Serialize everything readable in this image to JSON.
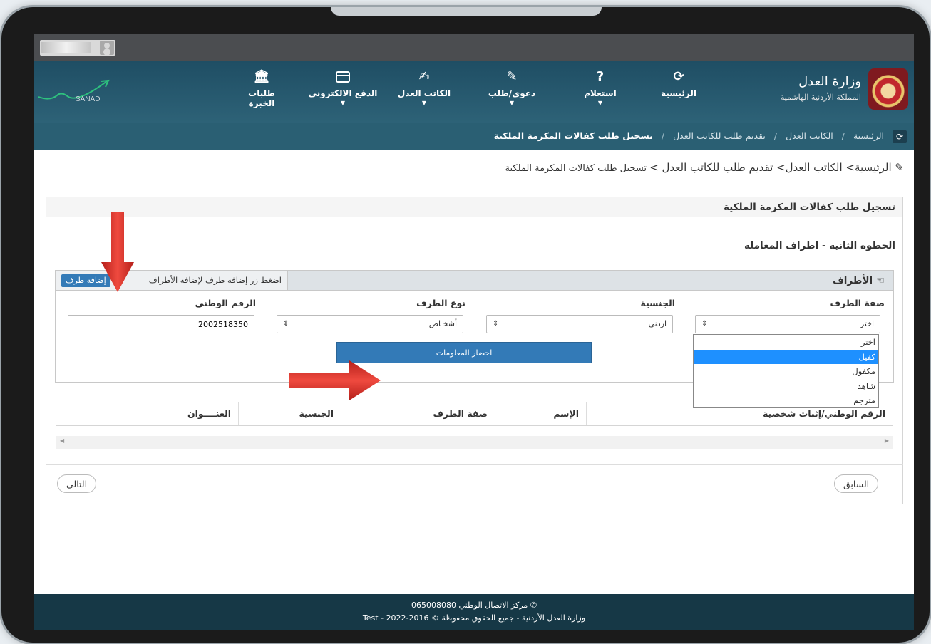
{
  "nav": {
    "brand": "SANAD",
    "items": [
      {
        "label": "الرئيسية",
        "icon": "refresh-icon",
        "glyph": "⟳",
        "caret": ""
      },
      {
        "label": "استعلام",
        "icon": "question-icon",
        "glyph": "?",
        "caret": "▼"
      },
      {
        "label": "دعوى/طلب",
        "icon": "pencil-icon",
        "glyph": "✎",
        "caret": "▼"
      },
      {
        "label": "الكاتب العدل",
        "icon": "edit-icon",
        "glyph": "✍",
        "caret": "▼"
      },
      {
        "label": "الدفع الالكتروني",
        "icon": "credit-card-icon",
        "glyph": "▭",
        "caret": "▼"
      },
      {
        "label": "طلبات الخبرة",
        "icon": "bank-icon",
        "glyph": "🏛",
        "caret": ""
      }
    ],
    "logo": {
      "line1": "وزارة العدل",
      "line2": "المملكة الأردنية الهاشمية"
    }
  },
  "breadcrumb": [
    "الرئيسية",
    "الكاتب العدل",
    "تقديم طلب للكاتب العدل",
    "تسجيل طلب كفالات المكرمة الملكية"
  ],
  "breadcrumb_sep": "/",
  "pathline": {
    "main": "الرئيسية> الكاتب العدل> تقديم طلب للكاتب العدل >",
    "tail": " تسجيل طلب كفالات المكرمة الملكية"
  },
  "panel": {
    "title": "تسجيل طلب كفالات المكرمة الملكية",
    "step": "الخطوة الثانية - اطراف المعاملة"
  },
  "parties": {
    "title": "الأطراف",
    "hint": "اضغط زر إضافة طرف لإضافة الأطراف",
    "add_button": "إضافة طرف",
    "fields": {
      "role_label": "صفة الطرف",
      "role_value": "اختر",
      "nationality_label": "الجنسية",
      "nationality_value": "اردنى",
      "type_label": "نوع الطرف",
      "type_value": "أشخـاص",
      "national_id_label": "الرقم الوطني",
      "national_id_value": "2002518350"
    },
    "fetch_button": "احضار المعلومات",
    "role_options": [
      "اختر",
      "كفيل",
      "مكفول",
      "شاهد",
      "مترجم"
    ],
    "role_highlighted": "كفيل"
  },
  "table": {
    "columns": [
      "الرقم الوطني/إثبات شخصية",
      "الإسم",
      "صفة الطرف",
      "الجنسية",
      "العنــــوان"
    ]
  },
  "buttons": {
    "prev": "السابق",
    "next": "التالي"
  },
  "footer": {
    "line1": "مركز الاتصال الوطني 065008080",
    "line2": "وزارة العدل الأردنية - جميع الحقوق محفوظة © 2016-2022 - Test"
  },
  "colors": {
    "nav": "#2d6277",
    "crumb": "#2a5f73",
    "primary": "#337ab7",
    "footer": "#163846",
    "arrow": "#d9332b"
  }
}
